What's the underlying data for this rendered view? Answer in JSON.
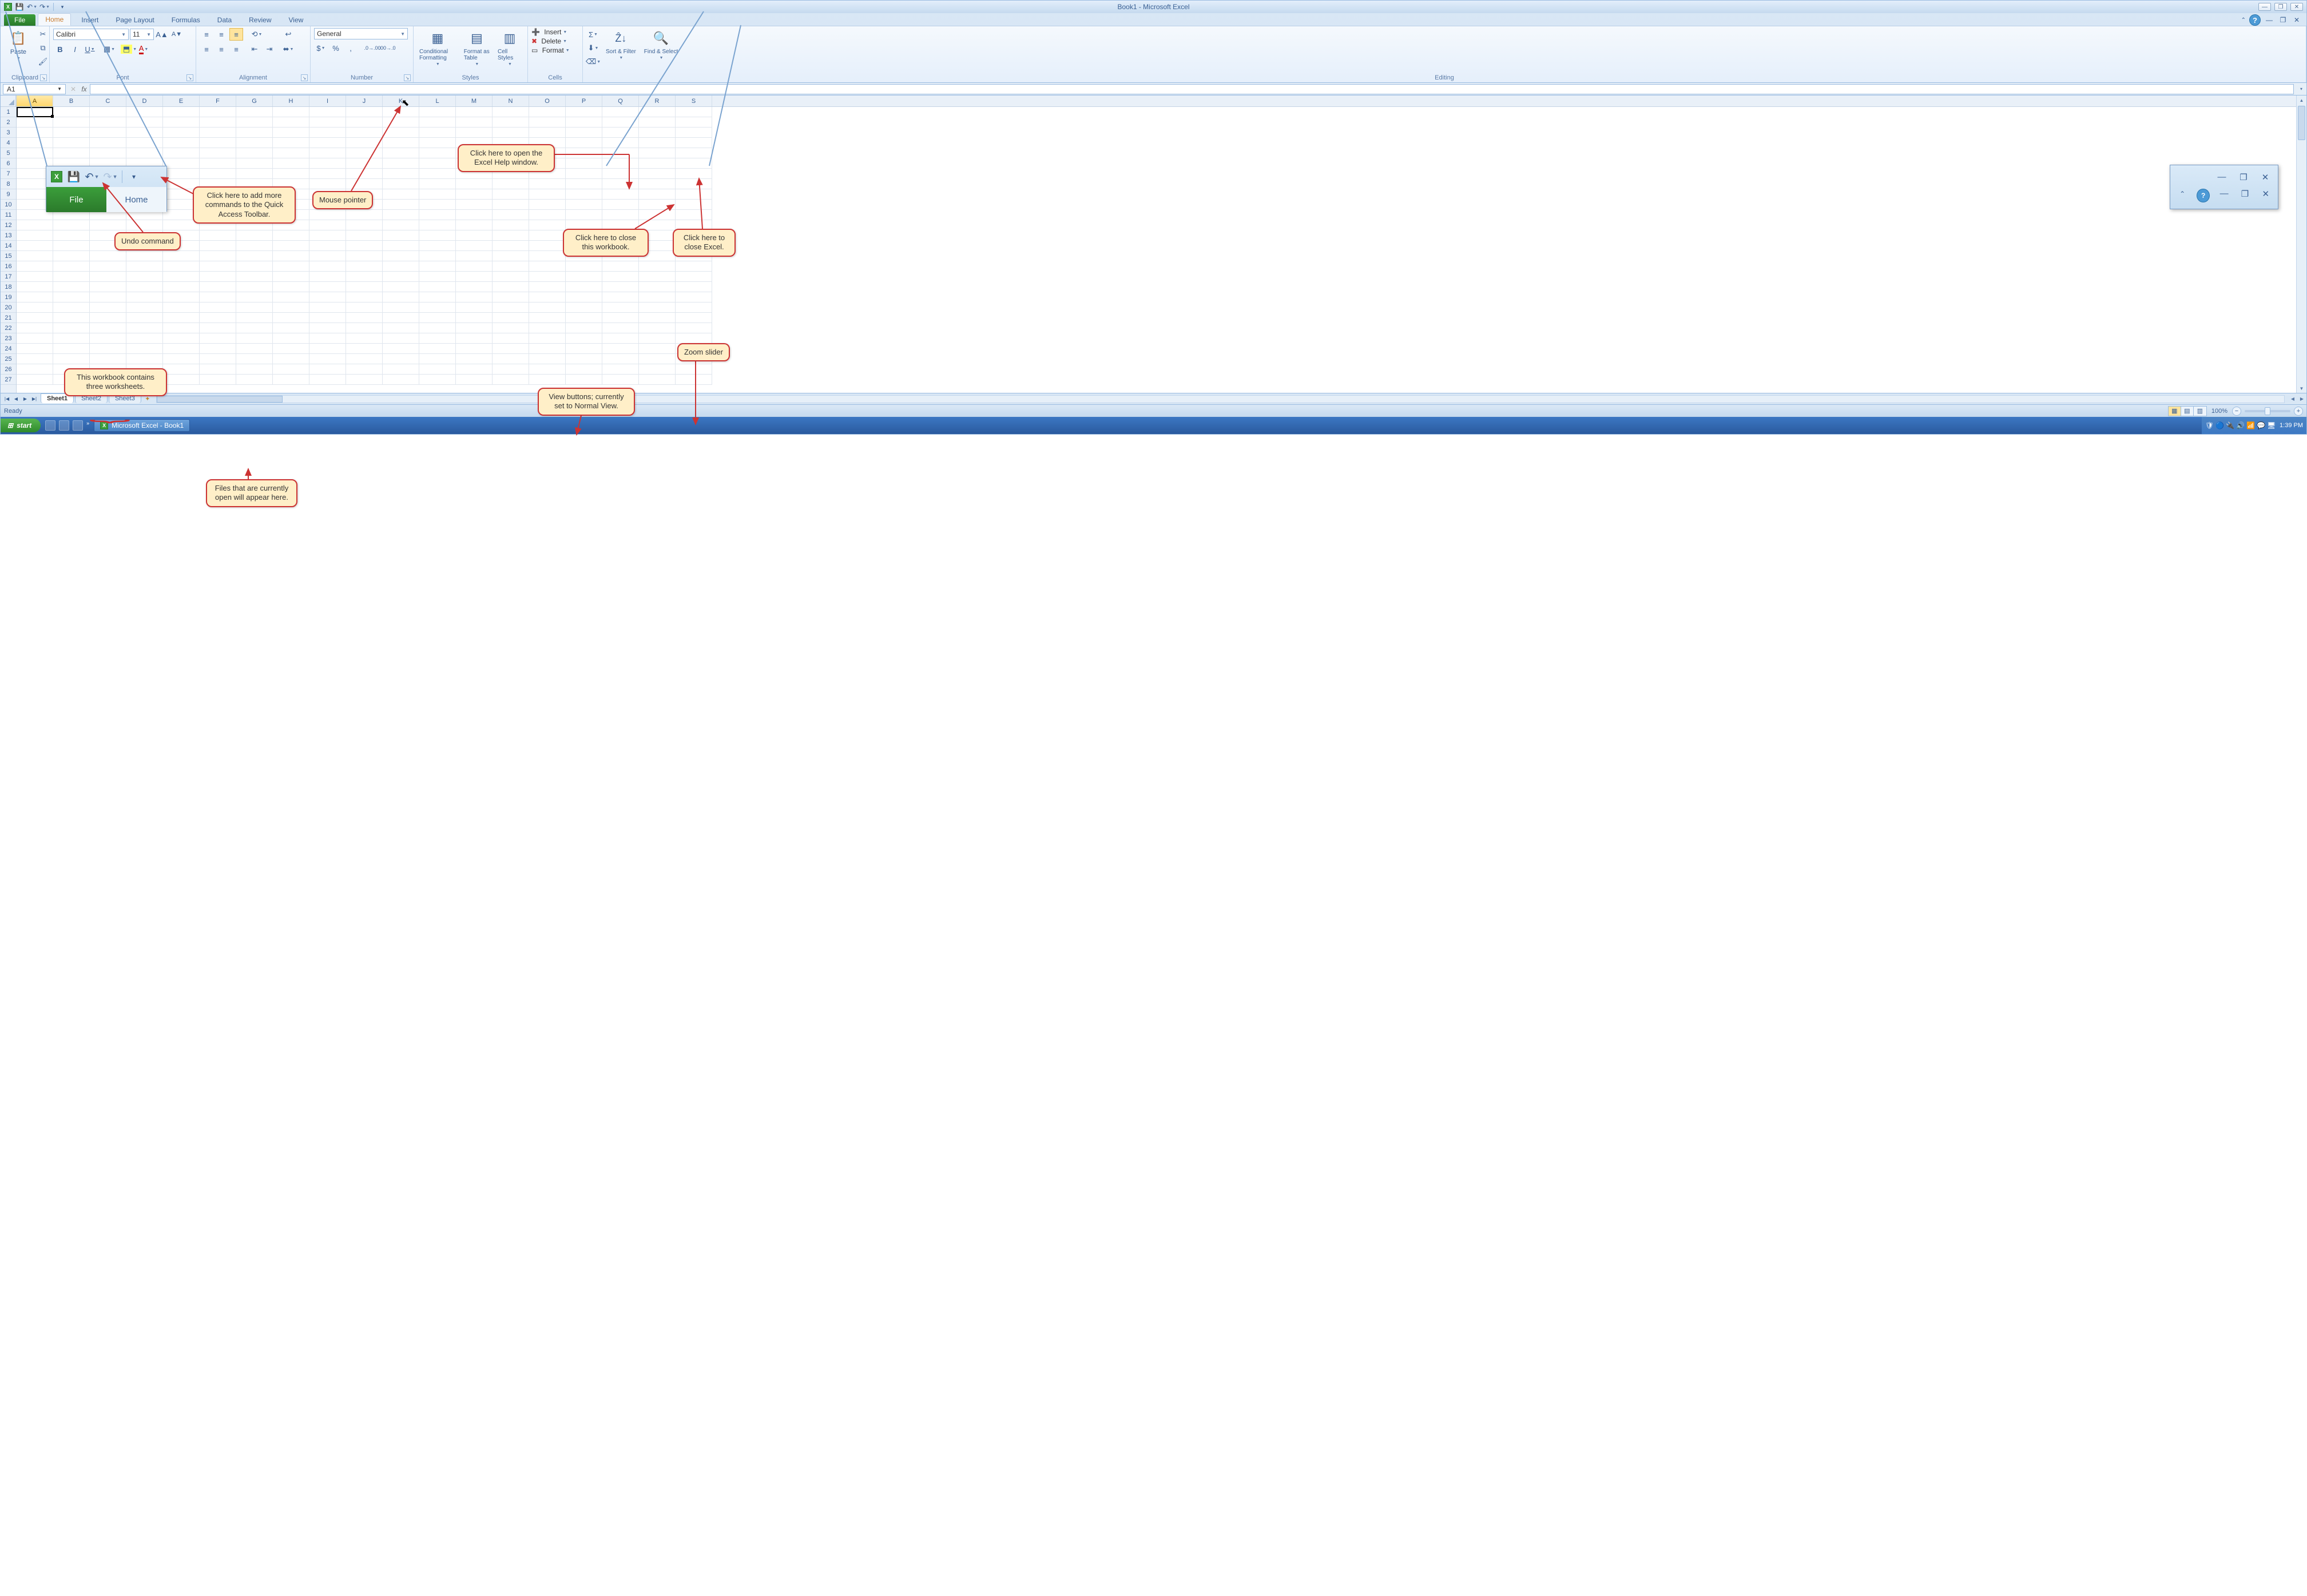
{
  "title": "Book1 - Microsoft Excel",
  "qat": {
    "save": "save-icon",
    "undo": "undo-icon",
    "redo": "redo-icon",
    "customize": "customize-qat-icon"
  },
  "tabs": {
    "file": "File",
    "home": "Home",
    "insert": "Insert",
    "page_layout": "Page Layout",
    "formulas": "Formulas",
    "data": "Data",
    "review": "Review",
    "view": "View"
  },
  "ribbon": {
    "clipboard": {
      "label": "Clipboard",
      "paste": "Paste"
    },
    "font": {
      "label": "Font",
      "name": "Calibri",
      "size": "11",
      "bold": "B",
      "italic": "I",
      "underline": "U"
    },
    "alignment": {
      "label": "Alignment"
    },
    "number": {
      "label": "Number",
      "format": "General"
    },
    "styles": {
      "label": "Styles",
      "conditional": "Conditional Formatting",
      "table": "Format as Table",
      "cell": "Cell Styles"
    },
    "cells": {
      "label": "Cells",
      "insert": "Insert",
      "delete": "Delete",
      "format": "Format"
    },
    "editing": {
      "label": "Editing",
      "sort": "Sort & Filter",
      "find": "Find & Select"
    }
  },
  "namebox": "A1",
  "columns": [
    "A",
    "B",
    "C",
    "D",
    "E",
    "F",
    "G",
    "H",
    "I",
    "J",
    "K",
    "L",
    "M",
    "N",
    "O",
    "P",
    "Q",
    "R",
    "S"
  ],
  "rows": [
    "1",
    "2",
    "3",
    "4",
    "5",
    "6",
    "7",
    "8",
    "9",
    "10",
    "11",
    "12",
    "13",
    "14",
    "15",
    "16",
    "17",
    "18",
    "19",
    "20",
    "21",
    "22",
    "23",
    "24",
    "25",
    "26",
    "27"
  ],
  "sheets": [
    "Sheet1",
    "Sheet2",
    "Sheet3"
  ],
  "status": "Ready",
  "zoom": "100%",
  "taskbar": {
    "start": "start",
    "app": "Microsoft Excel - Book1",
    "clock": "1:39 PM"
  },
  "inset": {
    "file": "File",
    "home": "Home"
  },
  "callouts": {
    "qat": "Click here to add more commands to the Quick Access Toolbar.",
    "undo": "Undo command",
    "help": "Click here to open the Excel Help window.",
    "mouse": "Mouse pointer",
    "close_wb": "Click here to close this workbook.",
    "close_app": "Click here to close Excel.",
    "zoom": "Zoom slider",
    "views": "View buttons; currently set to Normal View.",
    "sheets": "This workbook contains three worksheets.",
    "files": "Files that are currently open will appear here."
  }
}
